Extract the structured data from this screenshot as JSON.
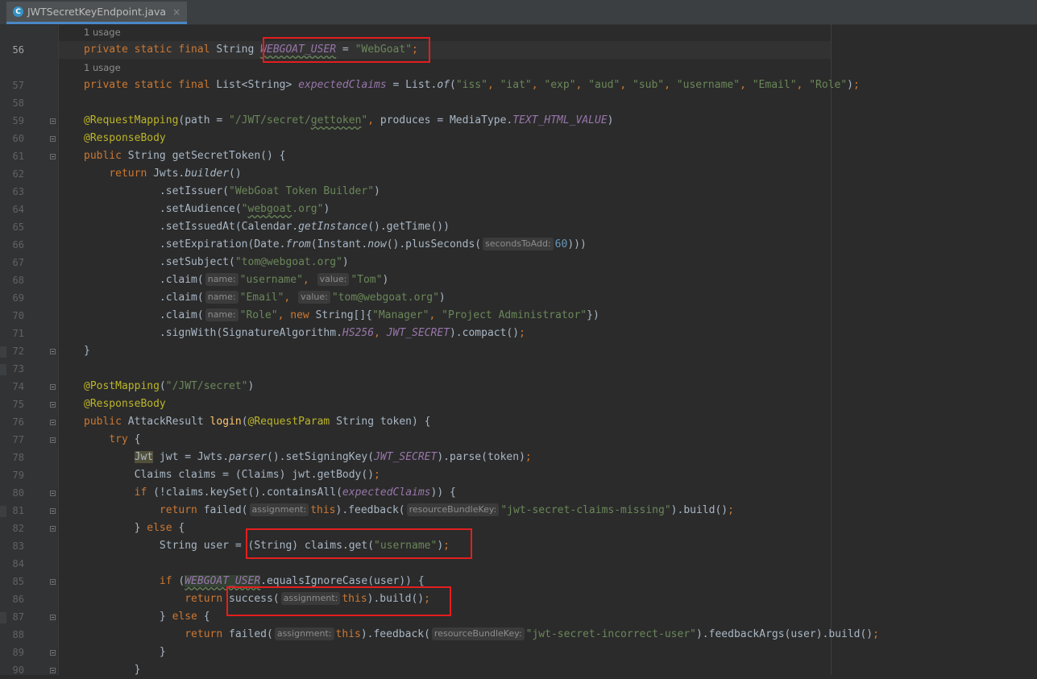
{
  "tab": {
    "title": "JWTSecretKeyEndpoint.java",
    "icon": "C",
    "close": "×"
  },
  "hints": {
    "usage1": "1 usage",
    "usage2": "1 usage"
  },
  "lines": [
    {
      "n": "56",
      "html": "<span class='kw'>private static final </span>String <span class='fld wavy'>WEBGOAT_USER</span> = <span class='str'>\"WebGoat\"</span><span class='kw'>;</span>"
    },
    {
      "n": "57",
      "html": "<span class='kw'>private static final </span>List&lt;String&gt; <span class='fld'>expectedClaims</span> = List.<span class='it'>of</span>(<span class='str'>\"iss\"</span><span class='kw'>, </span><span class='str'>\"iat\"</span><span class='kw'>, </span><span class='str'>\"exp\"</span><span class='kw'>, </span><span class='str'>\"aud\"</span><span class='kw'>, </span><span class='str'>\"sub\"</span><span class='kw'>, </span><span class='str'>\"username\"</span><span class='kw'>, </span><span class='str'>\"Email\"</span><span class='kw'>, </span><span class='str'>\"Role\"</span>)<span class='kw'>;</span>"
    },
    {
      "n": "58",
      "html": ""
    },
    {
      "n": "59",
      "html": "<span class='ann'>@RequestMapping</span>(path = <span class='str'>\"/JWT/secret/<span class='wavy'>gettoken</span>\"</span><span class='kw'>, </span>produces = MediaType.<span class='fld'>TEXT_HTML_VALUE</span>)"
    },
    {
      "n": "60",
      "html": "<span class='ann'>@ResponseBody</span>"
    },
    {
      "n": "61",
      "html": "<span class='kw'>public </span>String getSecretToken() {"
    },
    {
      "n": "62",
      "html": "    <span class='kw'>return </span>Jwts.<span class='it'>builder</span>()"
    },
    {
      "n": "63",
      "html": "            .setIssuer(<span class='str'>\"WebGoat Token Builder\"</span>)"
    },
    {
      "n": "64",
      "html": "            .setAudience(<span class='str'>\"<span class='wavy'>webgoat</span>.org\"</span>)"
    },
    {
      "n": "65",
      "html": "            .setIssuedAt(Calendar.<span class='it'>getInstance</span>().getTime())"
    },
    {
      "n": "66",
      "html": "            .setExpiration(Date.<span class='it'>from</span>(Instant.<span class='it'>now</span>().plusSeconds(<span class='ph'>secondsToAdd:</span><span class='num'>60</span>)))"
    },
    {
      "n": "67",
      "html": "            .setSubject(<span class='str'>\"tom@webgoat.org\"</span>)"
    },
    {
      "n": "68",
      "html": "            .claim(<span class='ph'>name:</span><span class='str'>\"username\"</span><span class='kw'>, </span><span class='ph'>value:</span><span class='str'>\"Tom\"</span>)"
    },
    {
      "n": "69",
      "html": "            .claim(<span class='ph'>name:</span><span class='str'>\"Email\"</span><span class='kw'>, </span><span class='ph'>value:</span><span class='str'>\"tom@webgoat.org\"</span>)"
    },
    {
      "n": "70",
      "html": "            .claim(<span class='ph'>name:</span><span class='str'>\"Role\"</span><span class='kw'>, new </span>String[]{<span class='str'>\"Manager\"</span><span class='kw'>, </span><span class='str'>\"Project Administrator\"</span>})"
    },
    {
      "n": "71",
      "html": "            .signWith(SignatureAlgorithm.<span class='fld'>HS256</span><span class='kw'>, </span><span class='fld'>JWT_SECRET</span>).compact()<span class='kw'>;</span>"
    },
    {
      "n": "72",
      "html": "}"
    },
    {
      "n": "73",
      "html": ""
    },
    {
      "n": "74",
      "html": "<span class='ann'>@PostMapping</span>(<span class='str'>\"/JWT/secret\"</span>)"
    },
    {
      "n": "75",
      "html": "<span class='ann'>@ResponseBody</span>"
    },
    {
      "n": "76",
      "html": "<span class='kw'>public </span>AttackResult <span class='mth'>login</span>(<span class='ann'>@RequestParam </span>String token) {"
    },
    {
      "n": "77",
      "html": "    <span class='kw'>try </span>{"
    },
    {
      "n": "78",
      "html": "        <span class='jwt'>Jwt</span> jwt = Jwts.<span class='it'>parser</span>().setSigningKey(<span class='fld'>JWT_SECRET</span>).parse(token)<span class='kw'>;</span>"
    },
    {
      "n": "79",
      "html": "        Claims claims = (Claims) jwt.getBody()<span class='kw'>;</span>"
    },
    {
      "n": "80",
      "html": "        <span class='kw'>if </span>(!claims.keySet().containsAll(<span class='fld'>expectedClaims</span>)) {"
    },
    {
      "n": "81",
      "html": "            <span class='kw'>return </span>failed(<span class='ph'>assignment:</span><span class='kw'>this</span>).feedback(<span class='ph'>resourceBundleKey:</span><span class='str'>\"jwt-secret-claims-missing\"</span>).build()<span class='kw'>;</span>"
    },
    {
      "n": "82",
      "html": "        } <span class='kw'>else </span>{"
    },
    {
      "n": "83",
      "html": "            String user = (String) claims.get(<span class='str'>\"username\"</span>)<span class='kw'>;</span>"
    },
    {
      "n": "84",
      "html": ""
    },
    {
      "n": "85",
      "html": "            <span class='kw'>if </span>(<span class='fld wavy hlbg'>WEBGOAT_USER</span>.equalsIgnoreCase(user)) {"
    },
    {
      "n": "86",
      "html": "                <span class='kw'>return </span>success(<span class='ph'>assignment:</span><span class='kw'>this</span>).build()<span class='kw'>;</span>"
    },
    {
      "n": "87",
      "html": "            } <span class='kw'>else </span>{"
    },
    {
      "n": "88",
      "html": "                <span class='kw'>return </span>failed(<span class='ph'>assignment:</span><span class='kw'>this</span>).feedback(<span class='ph'>resourceBundleKey:</span><span class='str'>\"jwt-secret-incorrect-user\"</span>).feedbackArgs(user).build()<span class='kw'>;</span>"
    },
    {
      "n": "89",
      "html": "            }"
    },
    {
      "n": "90",
      "html": "        }"
    }
  ]
}
